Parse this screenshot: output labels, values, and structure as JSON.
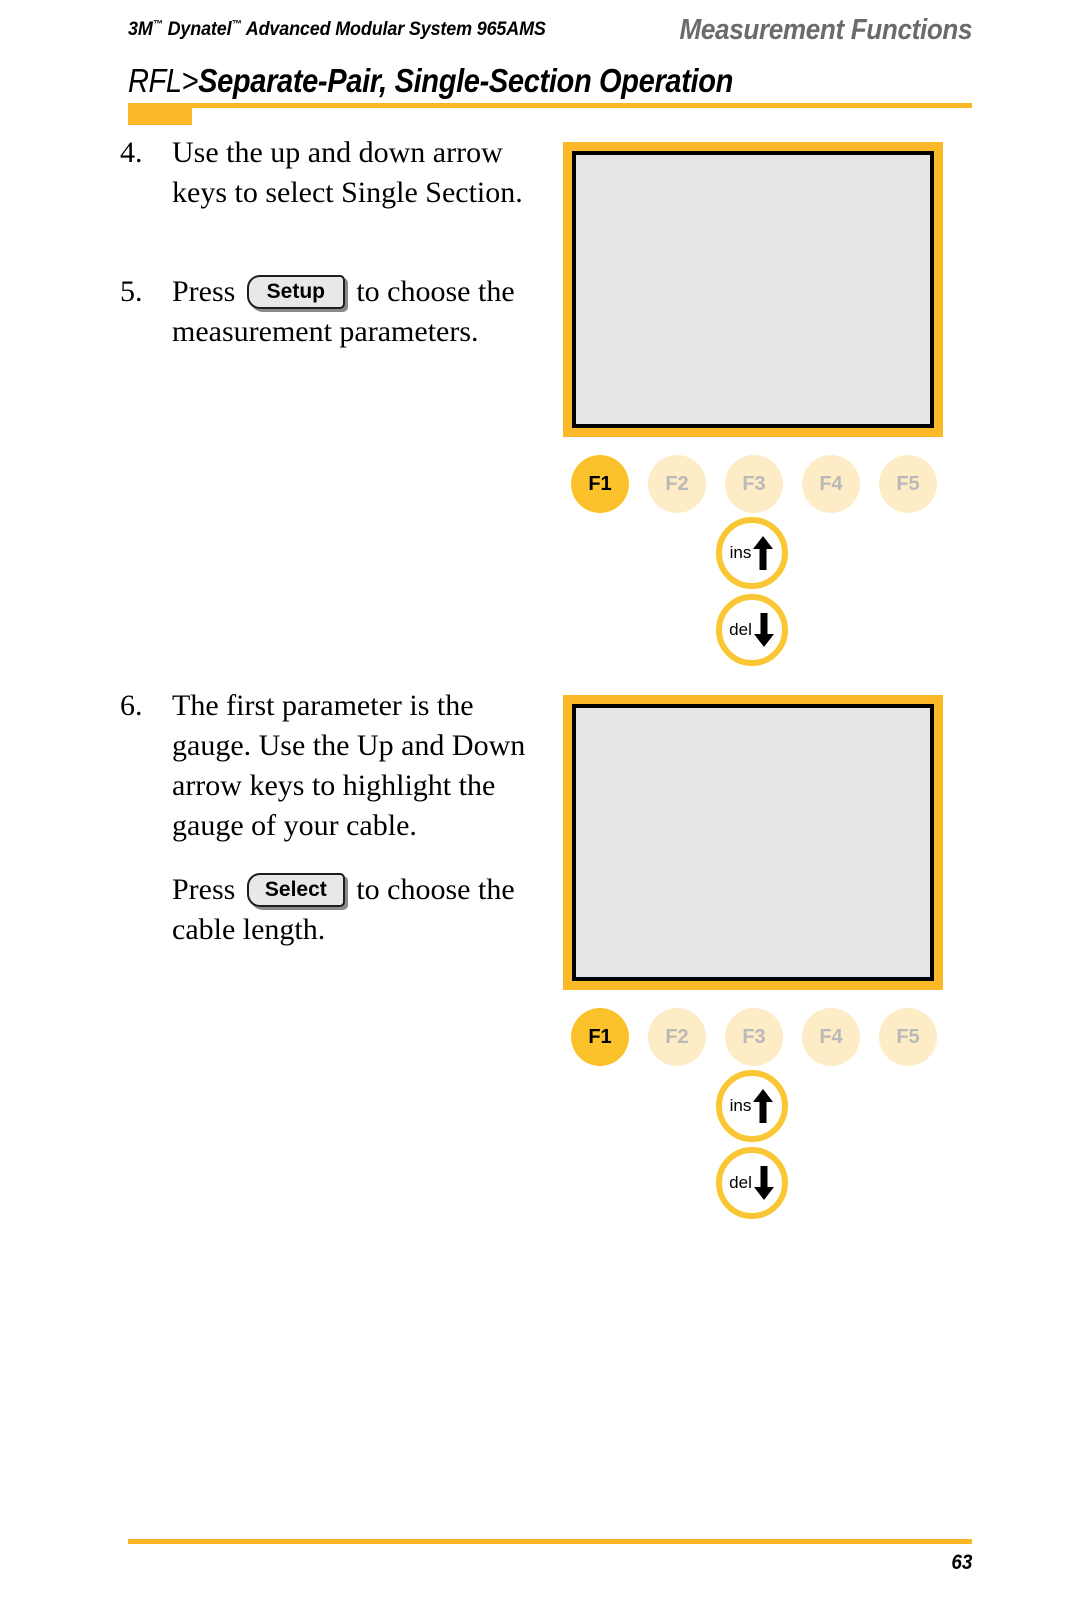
{
  "header": {
    "left_text_pre": "3M",
    "left_tm1": "™",
    "left_text_mid": " Dynatel",
    "left_tm2": "™",
    "left_text_post": " Advanced Modular System 965AMS",
    "right_text": "Measurement Functions"
  },
  "chapter": {
    "prefix": "RFL>",
    "main": "Separate-Pair, Single-Section Operation"
  },
  "steps": [
    {
      "number": "4.",
      "text": "Use the up and down arrow keys to select Single Section."
    },
    {
      "number": "5.",
      "text_before": "Press",
      "key_label": "Setup",
      "text_after": "to choose the measurement parameters."
    },
    {
      "number": "6.",
      "text": "The first parameter is the gauge. Use the Up and Down arrow keys to highlight the gauge of your cable.",
      "sub_text_before": "Press",
      "sub_key_label": "Select",
      "sub_text_after": "to choose the cable length."
    }
  ],
  "devices": [
    {
      "screen_text": "",
      "function_keys": [
        {
          "label": "F1",
          "active": true
        },
        {
          "label": "F2",
          "active": false
        },
        {
          "label": "F3",
          "active": false
        },
        {
          "label": "F4",
          "active": false
        },
        {
          "label": "F5",
          "active": false
        }
      ],
      "arrow_keys": [
        {
          "label": "ins",
          "direction": "up"
        },
        {
          "label": "del",
          "direction": "down"
        }
      ]
    },
    {
      "screen_text": "",
      "function_keys": [
        {
          "label": "F1",
          "active": true
        },
        {
          "label": "F2",
          "active": false
        },
        {
          "label": "F3",
          "active": false
        },
        {
          "label": "F4",
          "active": false
        },
        {
          "label": "F5",
          "active": false
        }
      ],
      "arrow_keys": [
        {
          "label": "ins",
          "direction": "up"
        },
        {
          "label": "del",
          "direction": "down"
        }
      ]
    }
  ],
  "footer": {
    "page_number": "63"
  },
  "colors": {
    "accent_yellow": "#fbb829",
    "rule_yellow": "#f9b726",
    "fkey_active": "#fcc22c",
    "fkey_inactive": "#fdecc6",
    "screen_gray": "#e4e5e7",
    "header_right_gray": "#6b6b6b"
  }
}
